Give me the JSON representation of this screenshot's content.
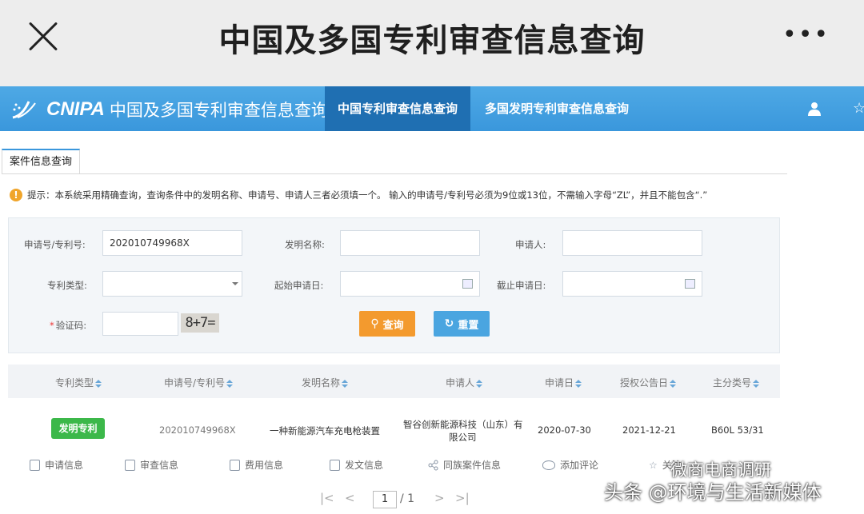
{
  "topbar": {
    "title": "中国及多国专利审查信息查询"
  },
  "navbar": {
    "logo_text": "CNIPA",
    "logo_name": "中国及多国专利审查信息查询",
    "tabs": [
      {
        "label": "中国专利审查信息查询",
        "active": true
      },
      {
        "label": "多国发明专利审查信息查询",
        "active": false
      }
    ]
  },
  "panel": {
    "tab_label": "案件信息查询",
    "notice": "提示：本系统采用精确查询，查询条件中的发明名称、申请号、申请人三者必须填一个。 输入的申请号/专利号必须为9位或13位，不需输入字母“ZL”，并且不能包含“.”"
  },
  "form": {
    "application_no_label": "申请号/专利号:",
    "application_no_value": "202010749968X",
    "invention_name_label": "发明名称:",
    "invention_name_value": "",
    "applicant_label": "申请人:",
    "applicant_value": "",
    "patent_type_label": "专利类型:",
    "patent_type_value": "",
    "start_date_label": "起始申请日:",
    "start_date_value": "",
    "end_date_label": "截止申请日:",
    "end_date_value": "",
    "captcha_label": "验证码:",
    "captcha_required_mark": "*",
    "captcha_value": "",
    "captcha_image_text": "8+7=",
    "search_button": "查询",
    "reset_button": "重置"
  },
  "table": {
    "headers": [
      "专利类型",
      "申请号/专利号",
      "发明名称",
      "申请人",
      "申请日",
      "授权公告日",
      "主分类号"
    ],
    "row": {
      "type": "发明专利",
      "application_no": "202010749968X",
      "title": "一种新能源汽车充电枪装置",
      "applicant_line1": "智谷创新能源科技（山东）有",
      "applicant_line2": "限公司",
      "filing_date": "2020-07-30",
      "grant_date": "2021-12-21",
      "ipc": "B60L 53/31"
    },
    "actions": [
      "申请信息",
      "审查信息",
      "费用信息",
      "发文信息",
      "同族案件信息",
      "添加评论",
      "关注"
    ]
  },
  "pagination": {
    "current_page": "1",
    "total": "/ 1"
  },
  "watermark": {
    "extra": "微商电商调研",
    "caption": "头条 @环境与生活新媒体"
  },
  "colors": {
    "nav_blue": "#3a97dc",
    "active_tab": "#1f6fb2",
    "search_orange": "#f39a2e",
    "badge_green": "#3cb84a"
  }
}
